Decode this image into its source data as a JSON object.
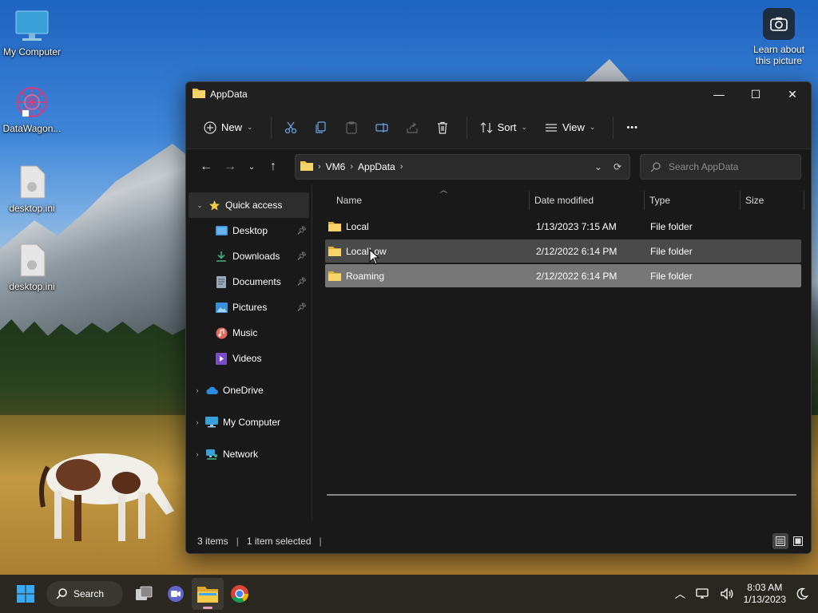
{
  "desktop": {
    "icons": [
      {
        "label": "My Computer"
      },
      {
        "label": "DataWagon..."
      },
      {
        "label": "desktop.ini"
      },
      {
        "label": "desktop.ini"
      }
    ],
    "spotlight": {
      "line1": "Learn about",
      "line2": "this picture"
    }
  },
  "window": {
    "title": "AppData",
    "controls": {
      "minimize": "—",
      "maximize": "☐",
      "close": "✕"
    }
  },
  "toolbar": {
    "new_label": "New",
    "sort_label": "Sort",
    "view_label": "View",
    "more_label": "•••"
  },
  "address": {
    "crumbs": [
      "VM6",
      "AppData"
    ],
    "search_placeholder": "Search AppData"
  },
  "navpane": {
    "quick_access": "Quick access",
    "items": [
      {
        "label": "Desktop",
        "pinned": true
      },
      {
        "label": "Downloads",
        "pinned": true
      },
      {
        "label": "Documents",
        "pinned": true
      },
      {
        "label": "Pictures",
        "pinned": true
      },
      {
        "label": "Music",
        "pinned": false
      },
      {
        "label": "Videos",
        "pinned": false
      }
    ],
    "onedrive": "OneDrive",
    "mycomputer": "My Computer",
    "network": "Network"
  },
  "columns": {
    "name": "Name",
    "date": "Date modified",
    "type": "Type",
    "size": "Size"
  },
  "files": [
    {
      "name": "Local",
      "date": "1/13/2023 7:15 AM",
      "type": "File folder"
    },
    {
      "name": "LocalLow",
      "date": "2/12/2022 6:14 PM",
      "type": "File folder"
    },
    {
      "name": "Roaming",
      "date": "2/12/2022 6:14 PM",
      "type": "File folder"
    }
  ],
  "status": {
    "items": "3 items",
    "selected": "1 item selected"
  },
  "taskbar": {
    "search_label": "Search",
    "time": "8:03 AM",
    "date": "1/13/2023"
  },
  "colors": {
    "accent": "#f2c94c",
    "selection": "#777777",
    "hover": "#4a4a4a"
  }
}
